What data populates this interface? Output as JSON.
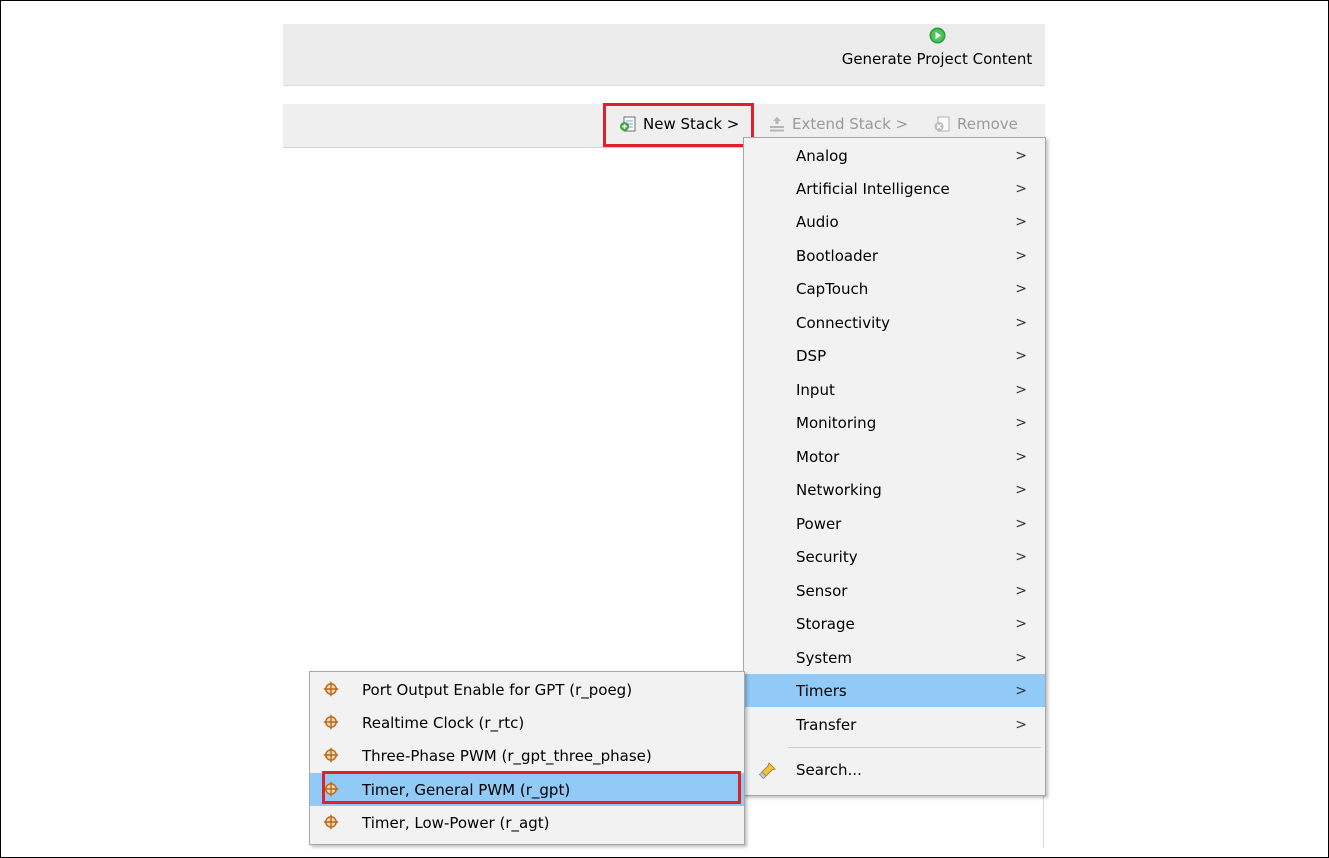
{
  "header": {
    "generate_label": "Generate Project Content"
  },
  "toolbar": {
    "new_stack_label": "New Stack >",
    "extend_stack_label": "Extend Stack >",
    "remove_label": "Remove"
  },
  "menu": {
    "categories": [
      {
        "label": "Analog"
      },
      {
        "label": "Artificial Intelligence"
      },
      {
        "label": "Audio"
      },
      {
        "label": "Bootloader"
      },
      {
        "label": "CapTouch"
      },
      {
        "label": "Connectivity"
      },
      {
        "label": "DSP"
      },
      {
        "label": "Input"
      },
      {
        "label": "Monitoring"
      },
      {
        "label": "Motor"
      },
      {
        "label": "Networking"
      },
      {
        "label": "Power"
      },
      {
        "label": "Security"
      },
      {
        "label": "Sensor"
      },
      {
        "label": "Storage"
      },
      {
        "label": "System"
      },
      {
        "label": "Timers"
      },
      {
        "label": "Transfer"
      }
    ],
    "search_label": "Search...",
    "arrow": ">",
    "selected": "Timers"
  },
  "submenu": {
    "items": [
      {
        "label": "Port Output Enable for GPT (r_poeg)"
      },
      {
        "label": "Realtime Clock (r_rtc)"
      },
      {
        "label": "Three-Phase PWM (r_gpt_three_phase)"
      },
      {
        "label": "Timer, General PWM (r_gpt)"
      },
      {
        "label": "Timer, Low-Power (r_agt)"
      }
    ],
    "selected": "Timer, General PWM (r_gpt)"
  },
  "colors": {
    "highlight_box": "#e0202a",
    "selection": "#91c9f7",
    "run_icon": "#2e9e3e"
  }
}
